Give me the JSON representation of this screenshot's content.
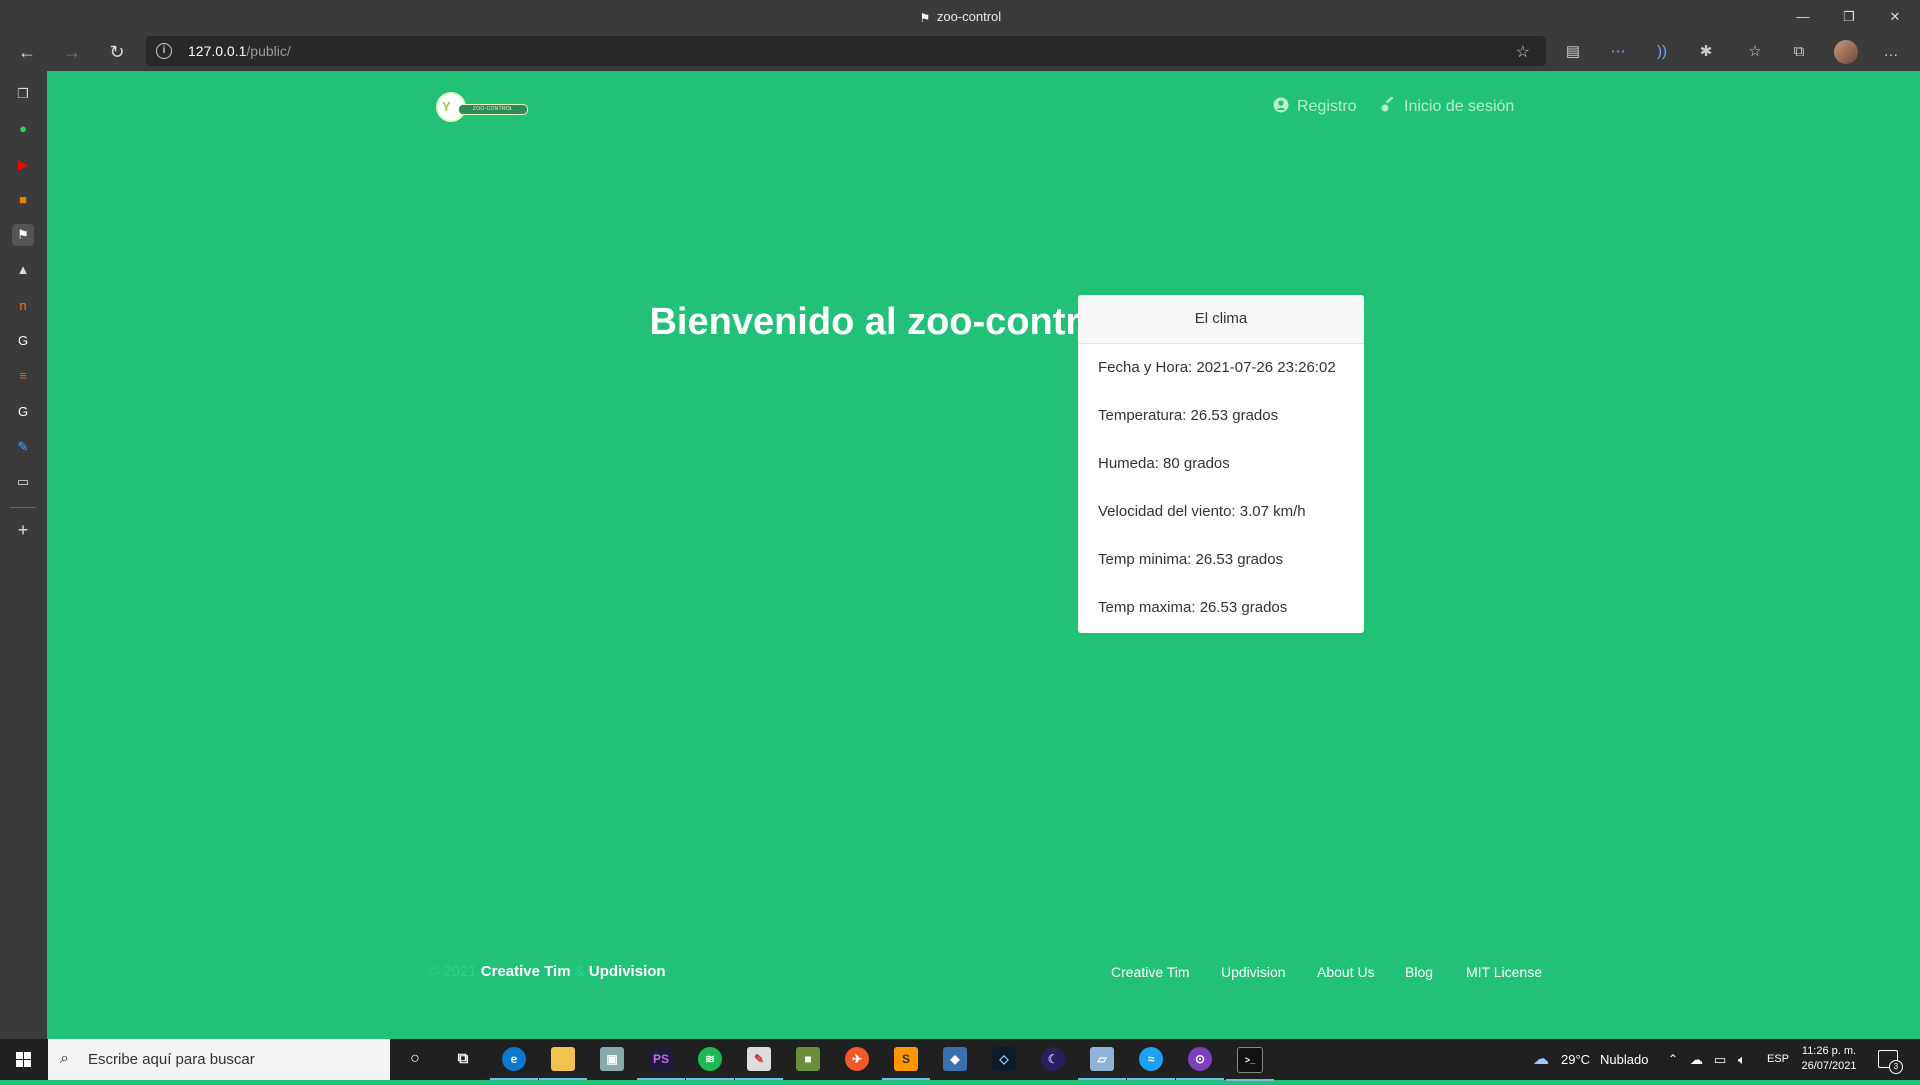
{
  "browser": {
    "window_title": "zoo-control",
    "url_host": "127.0.0.1",
    "url_path": "/public/"
  },
  "site": {
    "logo_text": "ZOO-CONTROL",
    "nav": {
      "register": "Registro",
      "login": "Inicio de sesión"
    },
    "welcome": "Bienvenido al zoo-control.",
    "weather_card": {
      "title": "El clima",
      "items": [
        "Fecha y Hora: 2021-07-26 23:26:02",
        "Temperatura: 26.53 grados",
        "Humeda: 80 grados",
        "Velocidad del viento: 3.07 km/h",
        "Temp minima: 26.53 grados",
        "Temp maxima: 26.53 grados"
      ]
    },
    "footer": {
      "copyright": "© 2021",
      "brand1": "Creative Tim",
      "amp": "&",
      "brand2": "Updivision",
      "links": [
        "Creative Tim",
        "Updivision",
        "About Us",
        "Blog",
        "MIT License"
      ]
    }
  },
  "taskbar": {
    "search_placeholder": "Escribe aquí para buscar",
    "weather_temp": "29°C",
    "weather_desc": "Nublado",
    "language": "ESP",
    "time": "11:26 p. m.",
    "date": "26/07/2021",
    "notifications": "3"
  },
  "colors": {
    "page_bg": "#21c177",
    "chrome_bg": "#3b3b3b",
    "taskbar_bg": "#202020"
  }
}
